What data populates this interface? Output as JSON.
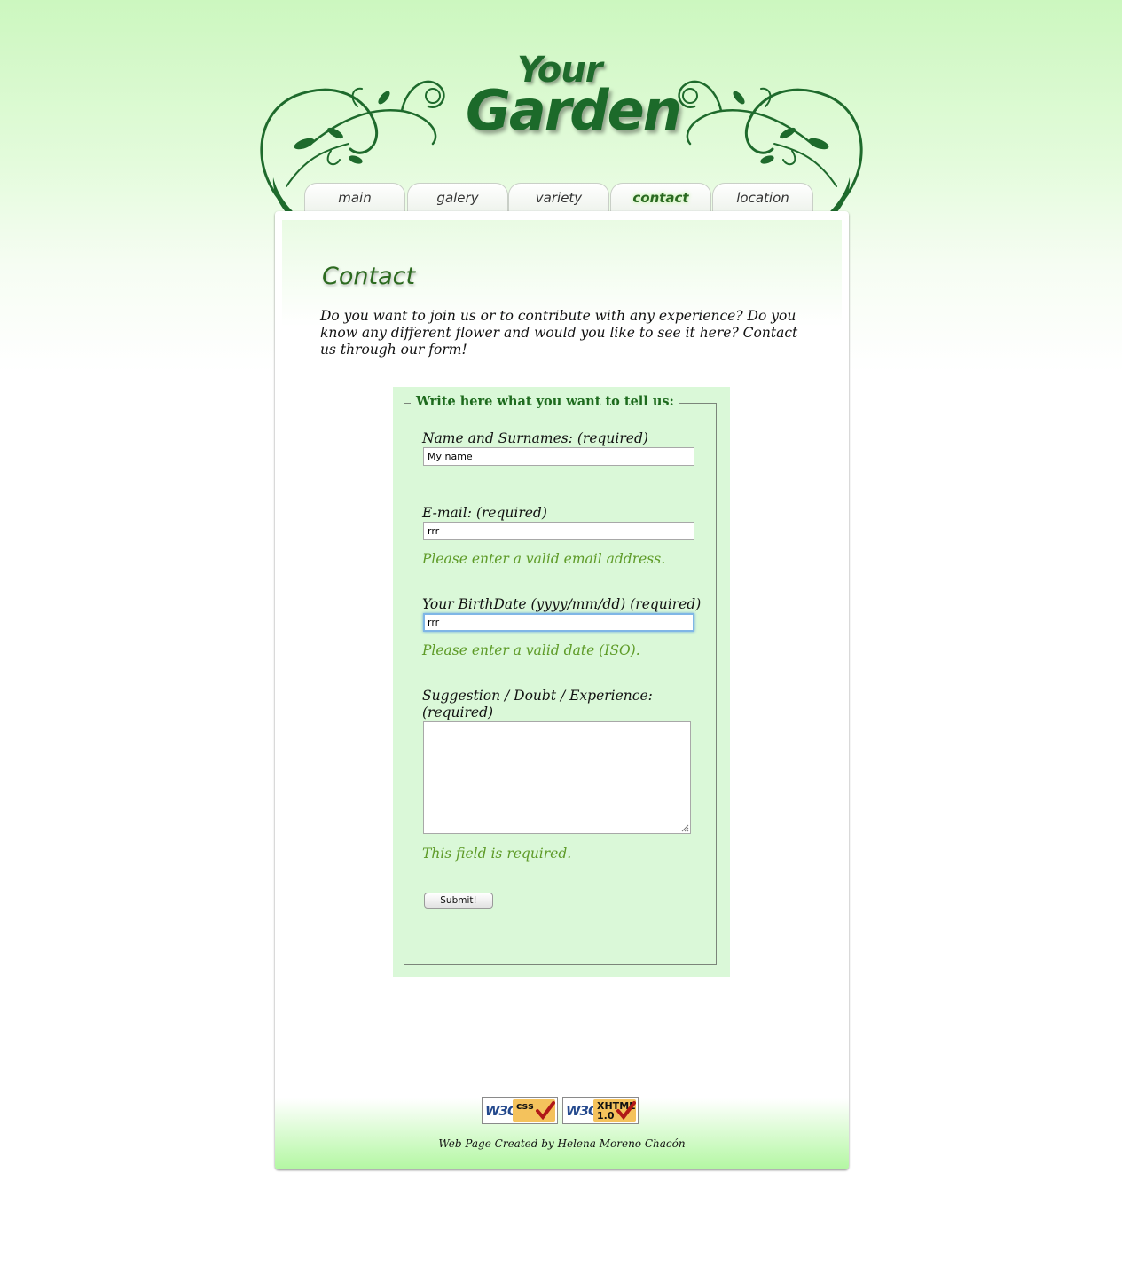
{
  "logo": {
    "line1": "Your",
    "line2": "Garden"
  },
  "nav": {
    "tabs": [
      {
        "label": "main",
        "active": false
      },
      {
        "label": "galery",
        "active": false
      },
      {
        "label": "variety",
        "active": false
      },
      {
        "label": "contact",
        "active": true
      },
      {
        "label": "location",
        "active": false
      }
    ]
  },
  "page": {
    "title": "Contact",
    "intro": "Do you want to join us or to contribute with any experience? Do you know any different flower and would you like to see it here? Contact us through our form!"
  },
  "form": {
    "legend": "Write here what you want to tell us:",
    "name": {
      "label": "Name and Surnames: (required)",
      "value": "My name"
    },
    "email": {
      "label": "E-mail: (required)",
      "value": "rrr",
      "error": "Please enter a valid email address."
    },
    "birthdate": {
      "label": "Your BirthDate (yyyy/mm/dd) (required)",
      "value": "rrr",
      "error": "Please enter a valid date (ISO)."
    },
    "message": {
      "label": "Suggestion / Doubt / Experience: (required)",
      "value": "",
      "error": "This field is required."
    },
    "submit_label": "Submit!"
  },
  "footer": {
    "badges": [
      {
        "issuer": "W3C",
        "kind": "css"
      },
      {
        "issuer": "W3C",
        "kind": "XHTML 1.0"
      }
    ],
    "credit": "Web Page Created by Helena Moreno Chacón"
  },
  "colors": {
    "brand_green": "#1c6a2a",
    "error_green": "#5e9b28",
    "form_background": "#daf8d8",
    "focus_blue": "#7fb6e6"
  },
  "icons": {
    "validator_check": "check-icon",
    "ornament": "vine-ornament"
  }
}
